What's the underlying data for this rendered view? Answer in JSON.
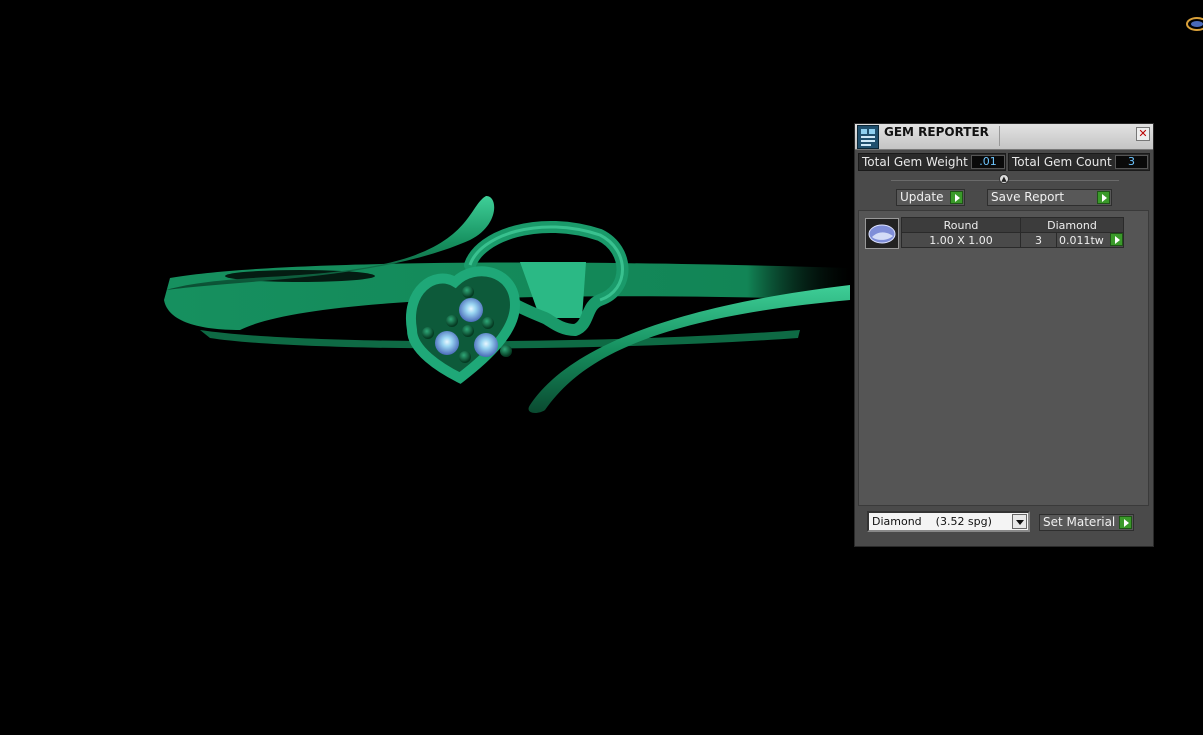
{
  "gem_reporter": {
    "title": "GEM REPORTER",
    "close_label": "✕",
    "total_gem_weight_label": "Total Gem Weight",
    "total_gem_weight_value": ".01",
    "total_gem_count_label": "Total Gem Count",
    "total_gem_count_value": "3",
    "update_label": "Update",
    "save_report_label": "Save Report",
    "gems": [
      {
        "shape": "Round",
        "material": "Diamond",
        "size": "1.00 X 1.00",
        "count": "3",
        "weight": "0.011tw"
      }
    ],
    "material_select": "Diamond    (3.52 spg)",
    "set_material_label": "Set Material"
  },
  "colors": {
    "ring_green": "#1a9a6a",
    "go_button_green": "#3a9a2a",
    "value_text_blue": "#6ec6ff"
  }
}
